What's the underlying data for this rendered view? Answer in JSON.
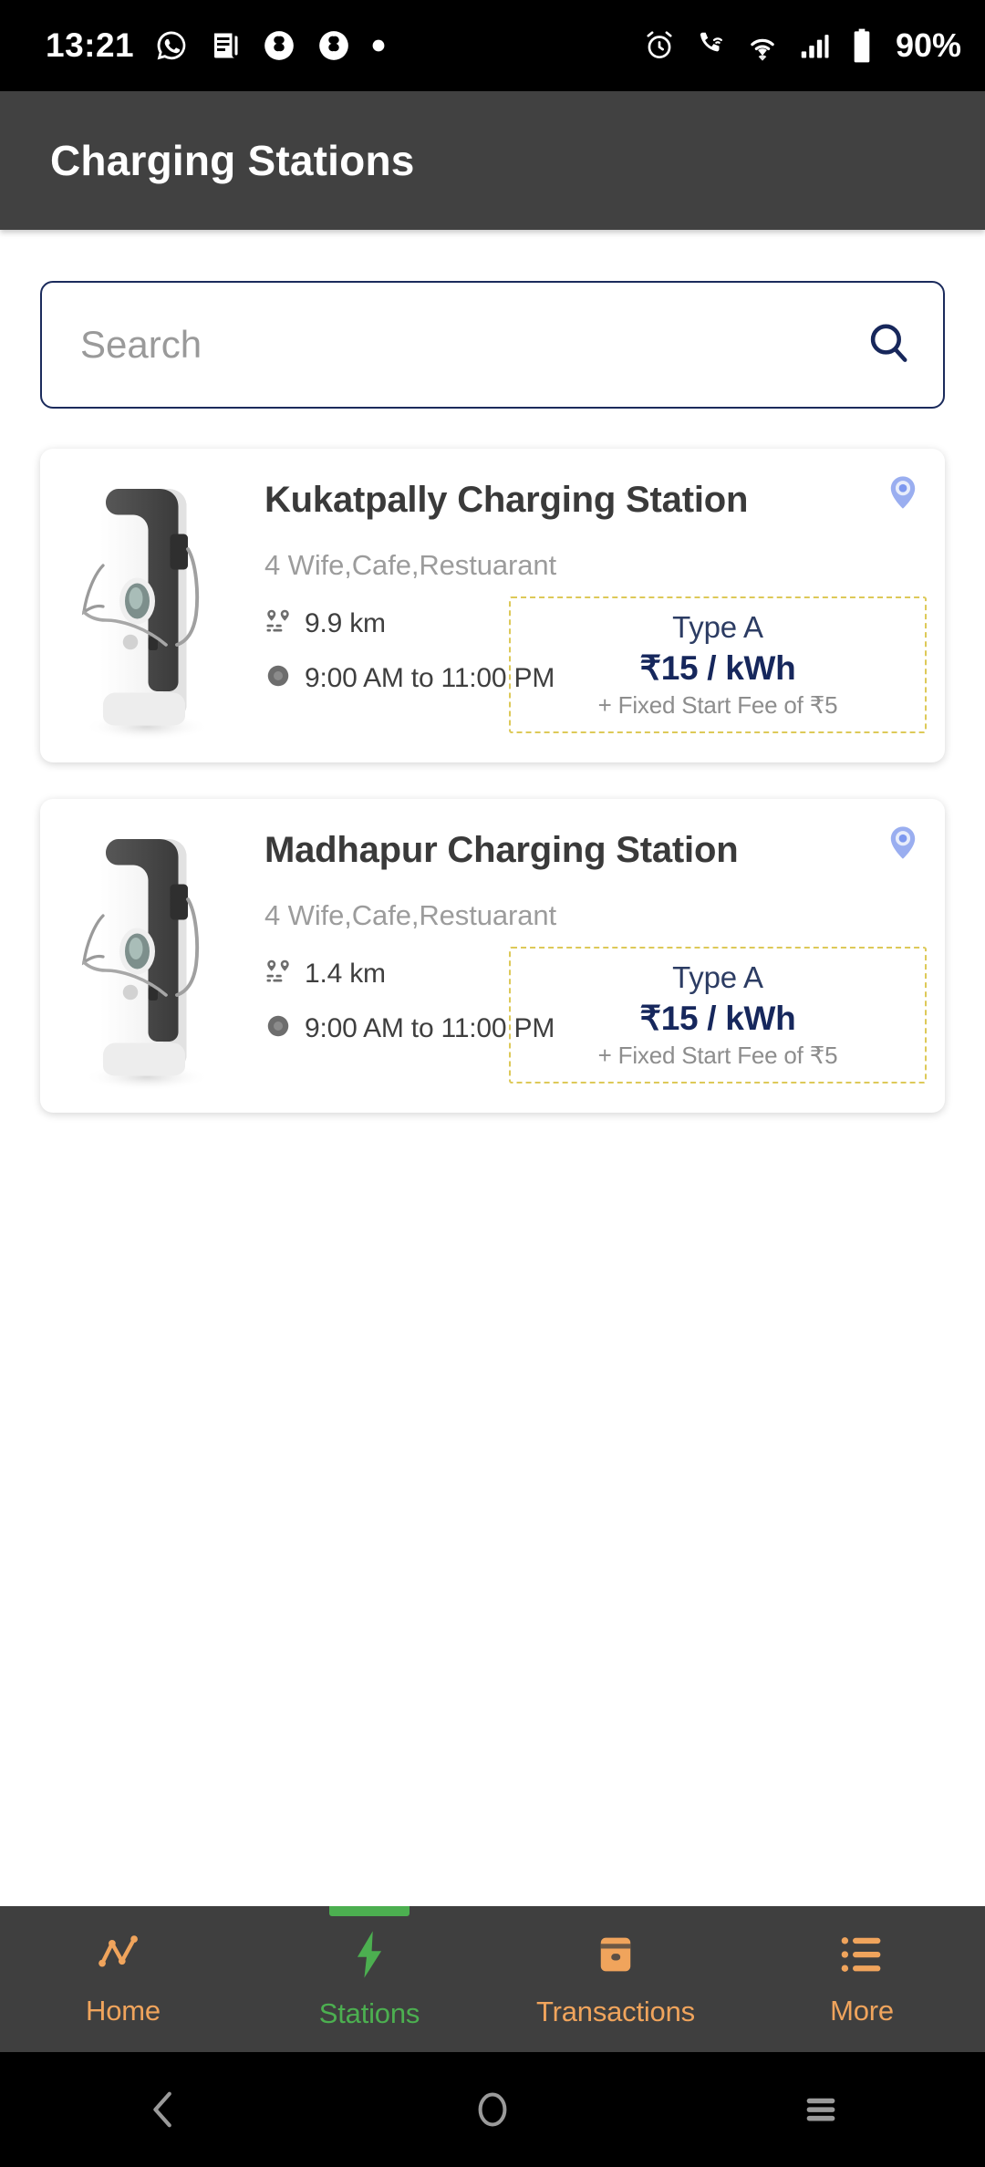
{
  "status_bar": {
    "time": "13:21",
    "battery_percent": "90%",
    "left_icons": [
      "whatsapp-icon",
      "news-article-icon",
      "app-icon-1",
      "app-icon-2",
      "dot-icon"
    ],
    "right_icons": [
      "alarm-clock-icon",
      "phone-wifi-calling-icon",
      "wifi-icon",
      "cellular-signal-icon",
      "battery-icon"
    ]
  },
  "header": {
    "title": "Charging Stations",
    "background_color": "#414141"
  },
  "search": {
    "placeholder": "Search",
    "value": "",
    "icon": "search-icon",
    "border_color": "#1b2b5c"
  },
  "stations": [
    {
      "name": "Kukatpally Charging Station",
      "amenities": "4 Wife,Cafe,Restuarant",
      "distance": "9.9 km",
      "hours": "9:00 AM to 11:00 PM",
      "connector_type": "Type A",
      "rate": "₹15 / kWh",
      "fixed_fee": "+ Fixed Start Fee of ₹5",
      "pin_icon": "location-pin-icon",
      "image": "ev-charger-image"
    },
    {
      "name": "Madhapur Charging Station",
      "amenities": "4 Wife,Cafe,Restuarant",
      "distance": "1.4 km",
      "hours": "9:00 AM to 11:00 PM",
      "connector_type": "Type A",
      "rate": "₹15 / kWh",
      "fixed_fee": "+ Fixed Start Fee of ₹5",
      "pin_icon": "location-pin-icon",
      "image": "ev-charger-image"
    }
  ],
  "bottom_nav": {
    "active": "Stations",
    "accent_color": "#f0a45c",
    "active_color": "#4caf50",
    "items": [
      {
        "label": "Home",
        "icon": "line-chart-icon"
      },
      {
        "label": "Stations",
        "icon": "bolt-icon"
      },
      {
        "label": "Transactions",
        "icon": "card-icon"
      },
      {
        "label": "More",
        "icon": "list-icon"
      }
    ]
  },
  "android_nav": {
    "buttons": [
      {
        "name": "back-icon"
      },
      {
        "name": "home-circle-icon"
      },
      {
        "name": "recents-icon"
      }
    ]
  }
}
